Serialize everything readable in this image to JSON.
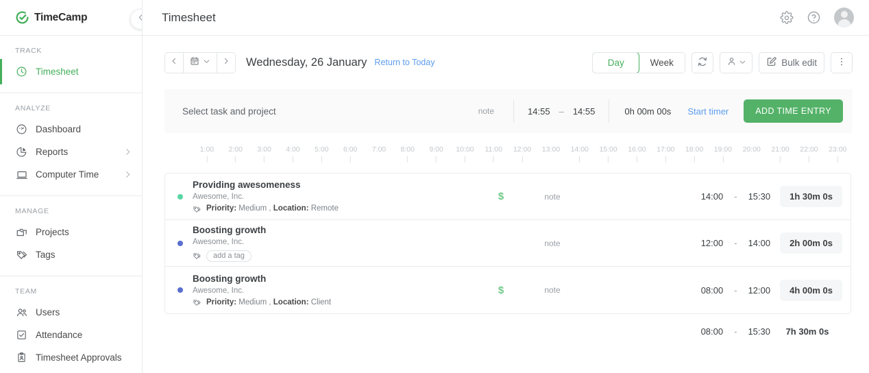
{
  "brand": {
    "name": "TimeCamp",
    "accent": "#45b05c"
  },
  "sidebar": {
    "collapse_icon": "chevron-left-icon",
    "sections": [
      {
        "heading": "TRACK",
        "items": [
          {
            "label": "Timesheet",
            "icon": "clock-icon",
            "active": true,
            "chevron": false
          }
        ]
      },
      {
        "heading": "ANALYZE",
        "items": [
          {
            "label": "Dashboard",
            "icon": "gauge-icon",
            "active": false,
            "chevron": false
          },
          {
            "label": "Reports",
            "icon": "pie-chart-icon",
            "active": false,
            "chevron": true
          },
          {
            "label": "Computer Time",
            "icon": "laptop-icon",
            "active": false,
            "chevron": true
          }
        ]
      },
      {
        "heading": "MANAGE",
        "items": [
          {
            "label": "Projects",
            "icon": "folders-icon",
            "active": false,
            "chevron": false
          },
          {
            "label": "Tags",
            "icon": "tag-icon",
            "active": false,
            "chevron": false
          }
        ]
      },
      {
        "heading": "TEAM",
        "items": [
          {
            "label": "Users",
            "icon": "users-icon",
            "active": false,
            "chevron": false
          },
          {
            "label": "Attendance",
            "icon": "checkbox-icon",
            "active": false,
            "chevron": false
          },
          {
            "label": "Timesheet Approvals",
            "icon": "clipboard-person-icon",
            "active": false,
            "chevron": false
          }
        ]
      }
    ]
  },
  "header": {
    "title": "Timesheet",
    "settings_icon": "gear-icon",
    "help_icon": "question-circle-icon",
    "avatar_icon": "user-avatar"
  },
  "toolbar": {
    "prev_icon": "chevron-left-icon",
    "calendar_icon": "calendar-icon",
    "calendar_chevron_icon": "chevron-down-icon",
    "next_icon": "chevron-right-icon",
    "date_label": "Wednesday, 26 January",
    "return_to_today": "Return to Today",
    "view_modes": [
      {
        "label": "Day",
        "selected": true
      },
      {
        "label": "Week",
        "selected": false
      }
    ],
    "refresh_icon": "refresh-icon",
    "person_icon": "person-icon",
    "person_chevron_icon": "chevron-down-icon",
    "bulk_edit_label": "Bulk edit",
    "bulk_edit_icon": "edit-square-icon",
    "more_icon": "more-vertical-icon"
  },
  "timer": {
    "task_placeholder": "Select task and project",
    "note_label": "note",
    "start_time": "14:55",
    "separator": "–",
    "end_time": "14:55",
    "duration": "0h 00m 00s",
    "start_timer_label": "Start timer",
    "add_entry_label": "ADD TIME ENTRY"
  },
  "ruler": {
    "ticks": [
      {
        "label": "1:00",
        "mark": true
      },
      {
        "label": "2:00",
        "mark": true
      },
      {
        "label": "3:00",
        "mark": true
      },
      {
        "label": "4:00",
        "mark": true
      },
      {
        "label": "5:00",
        "mark": true
      },
      {
        "label": "6:00",
        "mark": true
      },
      {
        "label": "7:00",
        "mark": false
      },
      {
        "label": "8:00",
        "mark": true
      },
      {
        "label": "9:00",
        "mark": true
      },
      {
        "label": "10:00",
        "mark": true
      },
      {
        "label": "11:00",
        "mark": true
      },
      {
        "label": "12:00",
        "mark": true
      },
      {
        "label": "13:00",
        "mark": false
      },
      {
        "label": "14:00",
        "mark": true
      },
      {
        "label": "15:00",
        "mark": true
      },
      {
        "label": "16:00",
        "mark": true
      },
      {
        "label": "17:00",
        "mark": true
      },
      {
        "label": "18:00",
        "mark": true
      },
      {
        "label": "19:00",
        "mark": true
      },
      {
        "label": "20:00",
        "mark": false
      },
      {
        "label": "21:00",
        "mark": true
      },
      {
        "label": "22:00",
        "mark": true
      },
      {
        "label": "23:00",
        "mark": true
      }
    ]
  },
  "entries": [
    {
      "dot_color": "#5ad6a4",
      "title": "Providing awesomeness",
      "client": "Awesome, Inc.",
      "tag_icon": "tag-icon",
      "tag_type": "text",
      "tag_label_1": "Priority:",
      "tag_value_1": "Medium ,",
      "tag_label_2": "Location:",
      "tag_value_2": "Remote",
      "billable": "$",
      "note": "note",
      "start": "14:00",
      "separator": "-",
      "end": "15:30",
      "duration": "1h 30m 0s"
    },
    {
      "dot_color": "#5a6fd1",
      "title": "Boosting growth",
      "client": "Awesome, Inc.",
      "tag_icon": "tag-icon",
      "tag_type": "chip",
      "tag_chip_label": "add a tag",
      "billable": "",
      "note": "note",
      "start": "12:00",
      "separator": "-",
      "end": "14:00",
      "duration": "2h 00m 0s"
    },
    {
      "dot_color": "#5a6fd1",
      "title": "Boosting growth",
      "client": "Awesome, Inc.",
      "tag_icon": "tag-icon",
      "tag_type": "text",
      "tag_label_1": "Priority:",
      "tag_value_1": "Medium ,",
      "tag_label_2": "Location:",
      "tag_value_2": "Client",
      "billable": "$",
      "note": "note",
      "start": "08:00",
      "separator": "-",
      "end": "12:00",
      "duration": "4h 00m 0s"
    }
  ],
  "summary": {
    "start": "08:00",
    "separator": "-",
    "end": "15:30",
    "duration": "7h 30m 0s"
  }
}
